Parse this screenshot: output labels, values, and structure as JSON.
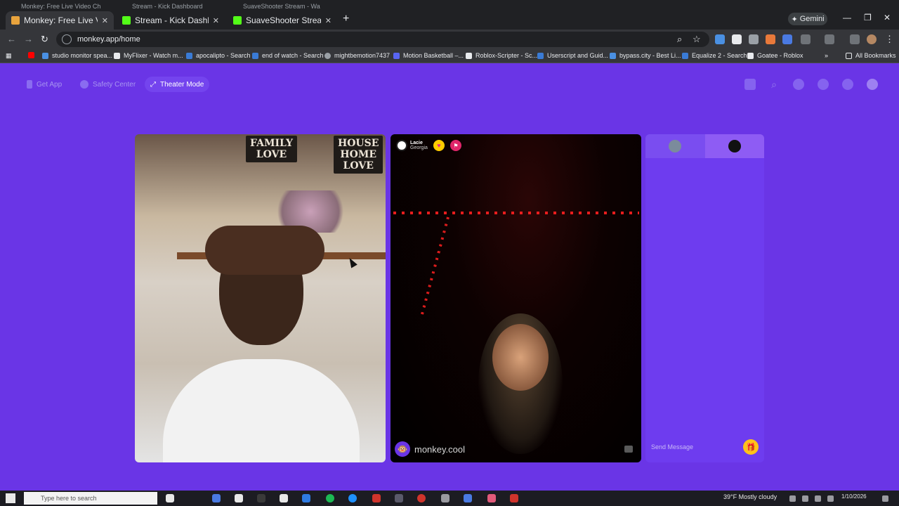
{
  "browser": {
    "tabs": [
      {
        "title": "Monkey: Free Live Video Ch",
        "color": "#e8a33d"
      },
      {
        "title": "Stream - Kick Dashboard",
        "color": "#53fc18"
      },
      {
        "title": "SuaveShooter Stream - Watch",
        "color": "#53fc18"
      }
    ],
    "ghost_tabs": [
      "Monkey: Free Live Video Ch",
      "Stream - Kick Dashboard",
      "SuaveShooter Stream - Watch"
    ],
    "gemini_label": "Gemini",
    "url": "monkey.app/home",
    "bookmarks": [
      "studio monitor spea...",
      "MyFlixer - Watch m...",
      "apocalipto - Search",
      "end of watch - Search",
      "mightbemotion7437",
      "Motion Basketball –...",
      "Roblox-Scripter - Sc...",
      "Userscript and Guid...",
      "bypass.city - Best Li...",
      "Equalize 2 - Search",
      "Goatee - Roblox"
    ],
    "all_bookmarks_label": "All Bookmarks"
  },
  "app": {
    "nav": {
      "get_app": "Get App",
      "safety_center": "Safety Center",
      "theater_mode": "Theater Mode"
    },
    "self_video": {
      "signs": [
        "FAMILY\nLOVE",
        "HOUSE\nHOME\nLOVE"
      ]
    },
    "peer": {
      "name": "Lacie",
      "location": "Georgia",
      "watermark": "monkey.cool"
    },
    "chat": {
      "placeholder": "Send Message"
    },
    "colors": {
      "background": "#6a35e6",
      "theater_active": "#7444ee",
      "chat_panel": "#6e3cef",
      "gift": "#ffc21a"
    }
  },
  "taskbar": {
    "search_placeholder": "Type here to search",
    "weather": "39°F  Mostly cloudy",
    "date": "1/10/2026"
  }
}
